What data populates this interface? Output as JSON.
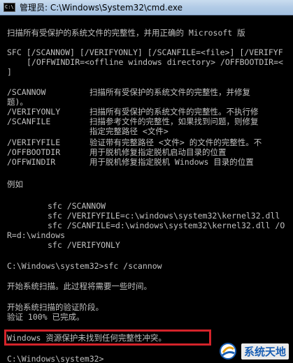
{
  "window": {
    "title": "管理员: C:\\Windows\\System32\\cmd.exe",
    "icon_text": "C:\\"
  },
  "console": {
    "intro": "扫描所有受保护的系统文件的完整性，并用正确的 Microsoft 版",
    "syntax_1": "SFC [/SCANNOW] [/VERIFYONLY] [/SCANFILE=<file>] [/VERIFYF",
    "syntax_2": "[/OFFWINDIR=<offline windows directory> /OFFBOOTDIR=<",
    "syntax_3": "]",
    "options": [
      {
        "name": "/SCANNOW",
        "desc": "扫描所有受保护的系统文件的完整性，并修复",
        "cont": "题)。"
      },
      {
        "name": "/VERIFYONLY",
        "desc": "扫描所有受保护的系统文件的完整性。不执行修"
      },
      {
        "name": "/SCANFILE",
        "desc": "扫描参考文件的完整性，如果找到问题，则修复",
        "cont": "指定完整路径 <文件>"
      },
      {
        "name": "/VERIFYFILE",
        "desc": "验证带有完整路径 <文件> 的文件的完整性。不"
      },
      {
        "name": "/OFFBOOTDIR",
        "desc": "用于脱机修复指定脱机启动目录的位置"
      },
      {
        "name": "/OFFWINDIR",
        "desc": "用于脱机修复指定脱机 Windows 目录的位置"
      }
    ],
    "example_heading": "例如",
    "examples": [
      "sfc /SCANNOW",
      "sfc /VERIFYFILE=c:\\windows\\system32\\kernel32.dll",
      "sfc /SCANFILE=d:\\windows\\system32\\kernel32.dll /O"
    ],
    "example_wrap": "R=d:\\windows",
    "example_last": "sfc /VERIFYONLY",
    "prompt_command": "C:\\Windows\\system32>sfc /scannow",
    "scan_start": "开始系统扫描。此过程将需要一些时间。",
    "verify_stage": "开始系统扫描的验证阶段。",
    "verify_done": "验证 100% 已完成。",
    "result": "Windows 资源保护未找到任何完整性冲突。",
    "final_prompt": "C:\\Windows\\system32>"
  },
  "watermark": {
    "text": "系统天地"
  },
  "colors": {
    "console_bg": "#000000",
    "console_text": "#c0c0c0",
    "highlight_border": "#d4232a",
    "titlebar": "#b2cbe6",
    "watermark_text": "#1a5fb4"
  }
}
